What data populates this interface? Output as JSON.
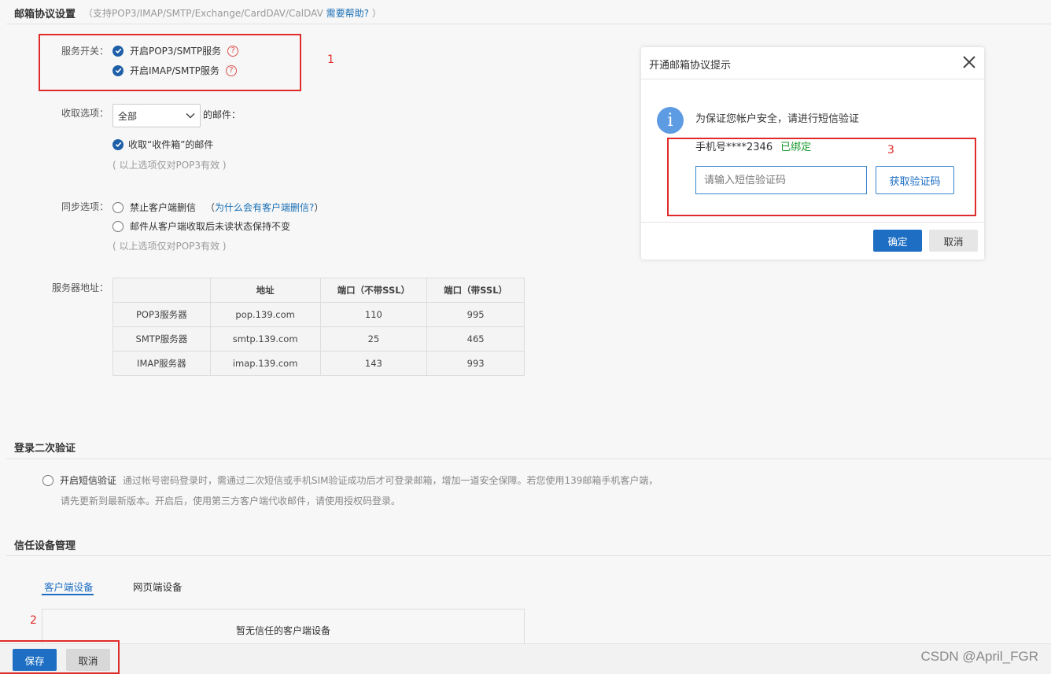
{
  "protocol_section": {
    "title": "邮箱协议设置",
    "subtitle_prefix": "（支持POP3/IMAP/SMTP/Exchange/CardDAV/CalDAV",
    "help_link": "需要帮助?",
    "subtitle_suffix": "）"
  },
  "service_switch": {
    "label": "服务开关：",
    "pop3_smtp": "开启POP3/SMTP服务",
    "imap_smtp": "开启IMAP/SMTP服务",
    "help_glyph": "?"
  },
  "receive_options": {
    "label": "收取选项：",
    "select_value": "全部",
    "select_suffix": "的邮件：",
    "inbox_checkbox": "收取“收件箱”的邮件",
    "note": "( 以上选项仅对POP3有效 )"
  },
  "sync_options": {
    "label": "同步选项：",
    "disable_delete": "禁止客户端删信",
    "why_link_prefix": "（",
    "why_link": "为什么会有客户端删信?",
    "why_link_suffix": "）",
    "keep_unread": "邮件从客户端收取后未读状态保持不变",
    "note": "( 以上选项仅对POP3有效 )"
  },
  "server_address": {
    "label": "服务器地址：",
    "headers": [
      "",
      "地址",
      "端口（不带SSL）",
      "端口（带SSL）"
    ],
    "rows": [
      [
        "POP3服务器",
        "pop.139.com",
        "110",
        "995"
      ],
      [
        "SMTP服务器",
        "smtp.139.com",
        "25",
        "465"
      ],
      [
        "IMAP服务器",
        "imap.139.com",
        "143",
        "993"
      ]
    ]
  },
  "two_step": {
    "title": "登录二次验证",
    "option": "开启短信验证",
    "desc_line1": "通过帐号密码登录时，需通过二次短信或手机SIM验证成功后才可登录邮箱，增加一道安全保障。若您使用139邮箱手机客户端，",
    "desc_line2": "请先更新到最新版本。开启后，使用第三方客户端代收邮件，请使用授权码登录。"
  },
  "trusted_devices": {
    "title": "信任设备管理",
    "tabs": [
      "客户端设备",
      "网页端设备"
    ],
    "empty_text": "暂无信任的客户端设备"
  },
  "footer": {
    "save": "保存",
    "cancel": "取消"
  },
  "annotations": {
    "n1": "1",
    "n2": "2",
    "n3": "3"
  },
  "modal": {
    "title": "开通邮箱协议提示",
    "info_glyph": "i",
    "message": "为保证您帐户安全，请进行短信验证",
    "phone_label": "手机号****2346",
    "bound_status": "已绑定",
    "sms_placeholder": "请输入短信验证码",
    "get_code": "获取验证码",
    "confirm": "确定",
    "cancel": "取消"
  },
  "watermark": "CSDN @April_FGR",
  "colors": {
    "primary": "#1e6fc4",
    "checkbox": "#1f5fa8",
    "annotation_red": "#e02b2b",
    "bound_green": "#1a9a2e"
  }
}
